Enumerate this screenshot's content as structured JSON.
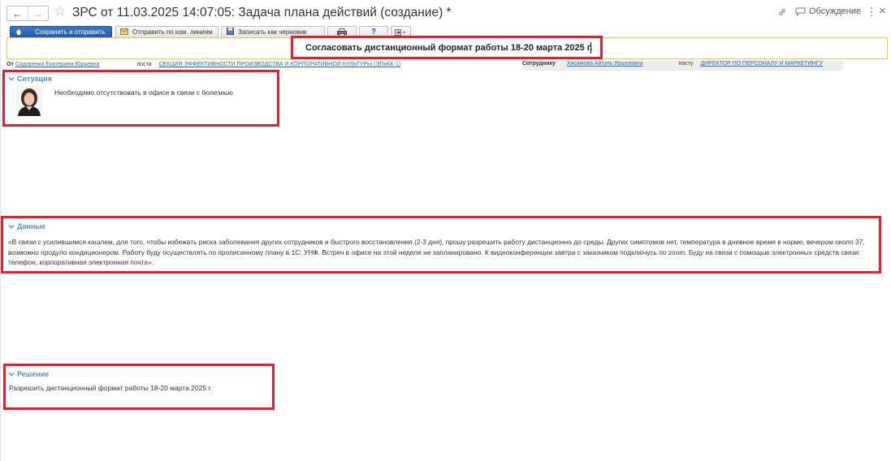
{
  "window": {
    "title": "ЗРС от 11.03.2025 14:07:05: Задача плана действий (создание) *",
    "discussion_label": "Обсуждение",
    "more_glyph": "⋮",
    "close_glyph": "×",
    "icons": [
      "back-arrow-icon",
      "forward-arrow-icon",
      "star-icon",
      "link-icon",
      "discussion-icon",
      "more-icon",
      "close-icon"
    ]
  },
  "toolbar": {
    "save_send_label": "Сохранить и отправить",
    "send_by_lines_label": "Отправить по ком. линиям",
    "save_draft_label": "Записать как черновик",
    "help_glyph": "?",
    "icons": [
      "send-icon",
      "send-by-lines-icon",
      "save-draft-icon",
      "print-icon",
      "help-icon",
      "more-actions-icon"
    ]
  },
  "header": {
    "subject": "Согласовать дистанционный формат работы 18-20 марта 2025 г.",
    "from_label": "От",
    "from_name": "Сидоренко Екатерина Юрьевна",
    "from_post_label": "поста",
    "from_post": "СЕКЦИЯ ЭФФЕКТИВНОСТИ ПРОИЗВОДСТВА И КОРПОРАТИВНОЙ КУЛЬТУРЫ (ЭПиКК-1)",
    "to_label": "Сотруднику",
    "to_name": "Хисамова Айгуль Уралловна",
    "to_post_label": "посту",
    "to_post": "ДИРЕКТОР ПО ПЕРСОНАЛУ И МАРКЕТИНГУ"
  },
  "situation": {
    "title": "Ситуация",
    "text": "Необходимо отсутствовать в офисе в связи с болезнью"
  },
  "data_section": {
    "title": "Данные",
    "text": "«В связи с усилившимся кашлем, для того, чтобы избежать риска заболевания других сотрудников и быстрого восстановления (2-3 дня), прошу разрешить работу дистанционно до среды. Других симптомов нет, температура в дневное время в норме, вечером около 37, возможно продуло кондиционером. Работу буду осуществлять по прописанному плану в 1С: УНФ. Встреч в офисе на этой неделе не запланировано. К видеоконференции завтра с заказчиком подключусь по zoom.  Буду на связи с помощью электронных средств связи: телефон, корпоративная электронная почта»."
  },
  "decision": {
    "title": "Решение",
    "text": "Разрешить дистанционный формат работы 18-20 марта 2025 г."
  },
  "colors": {
    "accent_blue": "#4a90d9",
    "link_blue": "#2a6db5",
    "annotation_red": "#e0202e",
    "field_focus_yellow": "#f2c542",
    "primary_button": "#2c66b5"
  }
}
